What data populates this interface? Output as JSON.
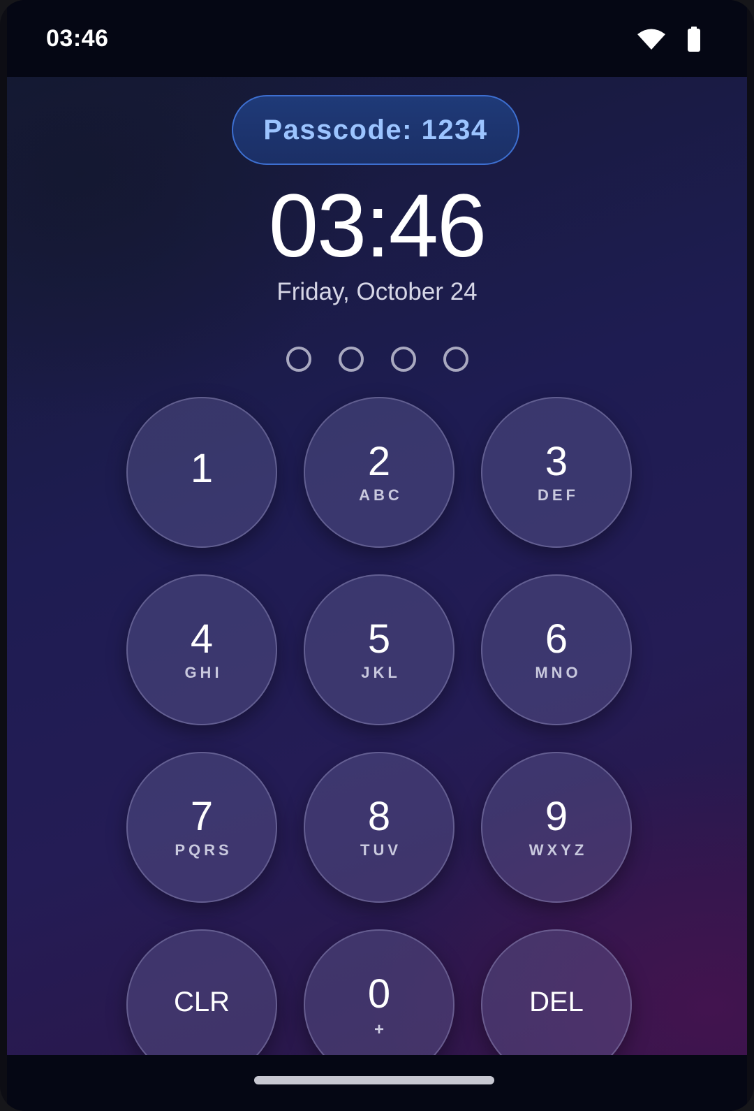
{
  "status_bar": {
    "time": "03:46",
    "icons": [
      "wifi-icon",
      "battery-icon"
    ]
  },
  "lock_screen": {
    "passcode_hint": "Passcode: 1234",
    "clock": "03:46",
    "date": "Friday, October 24",
    "pin_dot_count": 4,
    "pin_entered": 0
  },
  "keypad": {
    "k1": {
      "digit": "1",
      "letters": ""
    },
    "k2": {
      "digit": "2",
      "letters": "ABC"
    },
    "k3": {
      "digit": "3",
      "letters": "DEF"
    },
    "k4": {
      "digit": "4",
      "letters": "GHI"
    },
    "k5": {
      "digit": "5",
      "letters": "JKL"
    },
    "k6": {
      "digit": "6",
      "letters": "MNO"
    },
    "k7": {
      "digit": "7",
      "letters": "PQRS"
    },
    "k8": {
      "digit": "8",
      "letters": "TUV"
    },
    "k9": {
      "digit": "9",
      "letters": "WXYZ"
    },
    "clr": {
      "label": "CLR"
    },
    "k0": {
      "digit": "0",
      "letters": "+"
    },
    "del": {
      "label": "DEL"
    }
  },
  "colors": {
    "passcode_text": "#9cc4ff",
    "passcode_border": "#3d6fd0",
    "background_top": "#151a35",
    "background_bottom": "#2e1547"
  }
}
